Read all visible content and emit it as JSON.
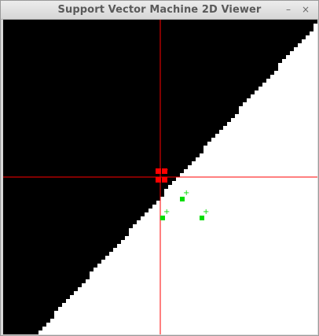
{
  "window": {
    "title": "Support Vector Machine 2D Viewer",
    "minimize_icon": "minimize-icon",
    "close_icon": "close-icon",
    "minimize_glyph": "–",
    "close_glyph": "×"
  },
  "plot": {
    "colors": {
      "region_negative": "#000000",
      "region_positive": "#ffffff",
      "crosshair": "#ff0000",
      "class_negative": "#ff0000",
      "class_positive": "#00dd00"
    },
    "decision_boundary": "staircase diagonal from bottom-left to top-right",
    "crosshair": "red horizontal and vertical lines through the negative-class cluster",
    "points_negative": [
      {
        "label": "-",
        "marker": "red-square"
      },
      {
        "label": "-",
        "marker": "red-square"
      },
      {
        "label": "-",
        "marker": "red-square"
      },
      {
        "label": "-",
        "marker": "red-square"
      }
    ],
    "points_positive": [
      {
        "label": "+",
        "marker": "green-square"
      },
      {
        "label": "+",
        "marker": "green-square"
      },
      {
        "label": "+",
        "marker": "green-square"
      }
    ]
  }
}
